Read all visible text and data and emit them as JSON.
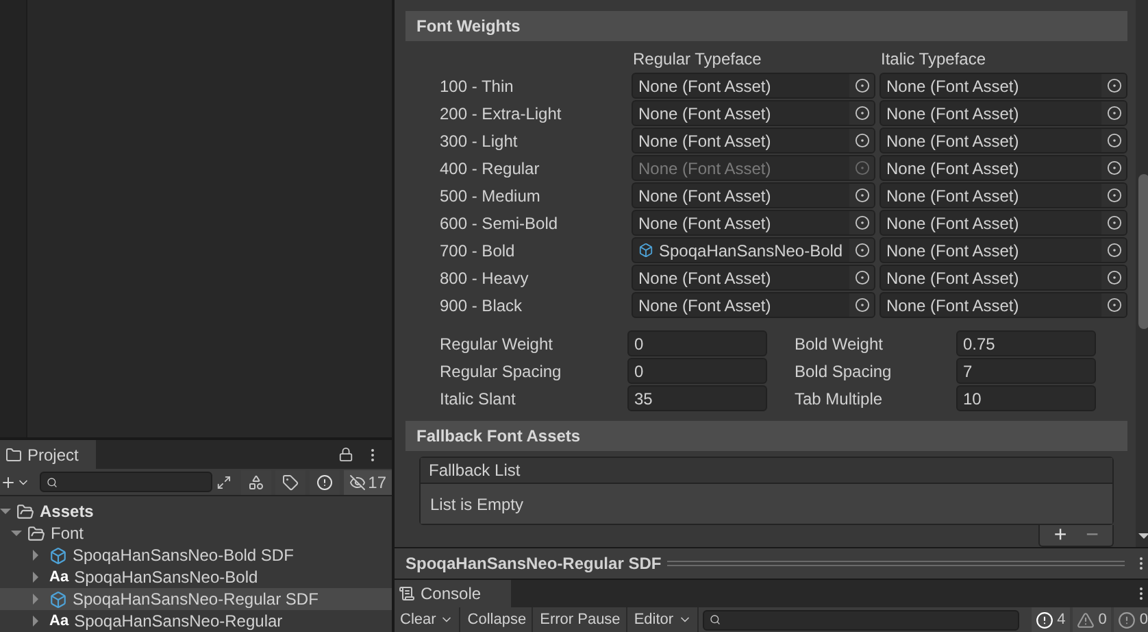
{
  "inspector": {
    "font_weights": {
      "title": "Font Weights",
      "columns": [
        "Regular Typeface",
        "Italic Typeface"
      ],
      "rows": [
        {
          "label": "100 - Thin",
          "regular": {
            "kind": "none",
            "text": "None (Font Asset)",
            "disabled": false
          },
          "italic": {
            "kind": "none",
            "text": "None (Font Asset)",
            "disabled": false
          }
        },
        {
          "label": "200 - Extra-Light",
          "regular": {
            "kind": "none",
            "text": "None (Font Asset)",
            "disabled": false
          },
          "italic": {
            "kind": "none",
            "text": "None (Font Asset)",
            "disabled": false
          }
        },
        {
          "label": "300 - Light",
          "regular": {
            "kind": "none",
            "text": "None (Font Asset)",
            "disabled": false
          },
          "italic": {
            "kind": "none",
            "text": "None (Font Asset)",
            "disabled": false
          }
        },
        {
          "label": "400 - Regular",
          "regular": {
            "kind": "none",
            "text": "None (Font Asset)",
            "disabled": true
          },
          "italic": {
            "kind": "none",
            "text": "None (Font Asset)",
            "disabled": false
          }
        },
        {
          "label": "500 - Medium",
          "regular": {
            "kind": "none",
            "text": "None (Font Asset)",
            "disabled": false
          },
          "italic": {
            "kind": "none",
            "text": "None (Font Asset)",
            "disabled": false
          }
        },
        {
          "label": "600 - Semi-Bold",
          "regular": {
            "kind": "none",
            "text": "None (Font Asset)",
            "disabled": false
          },
          "italic": {
            "kind": "none",
            "text": "None (Font Asset)",
            "disabled": false
          }
        },
        {
          "label": "700 - Bold",
          "regular": {
            "kind": "asset",
            "text": "SpoqaHanSansNeo-Bold",
            "disabled": false
          },
          "italic": {
            "kind": "none",
            "text": "None (Font Asset)",
            "disabled": false
          }
        },
        {
          "label": "800 - Heavy",
          "regular": {
            "kind": "none",
            "text": "None (Font Asset)",
            "disabled": false
          },
          "italic": {
            "kind": "none",
            "text": "None (Font Asset)",
            "disabled": false
          }
        },
        {
          "label": "900 - Black",
          "regular": {
            "kind": "none",
            "text": "None (Font Asset)",
            "disabled": false
          },
          "italic": {
            "kind": "none",
            "text": "None (Font Asset)",
            "disabled": false
          }
        }
      ],
      "settings": [
        {
          "label": "Regular Weight",
          "value": "0"
        },
        {
          "label": "Bold Weight",
          "value": "0.75"
        },
        {
          "label": "Regular Spacing",
          "value": "0"
        },
        {
          "label": "Bold Spacing",
          "value": "7"
        },
        {
          "label": "Italic Slant",
          "value": "35"
        },
        {
          "label": "Tab Multiple",
          "value": "10"
        }
      ]
    },
    "fallback": {
      "title": "Fallback Font Assets",
      "list_header": "Fallback List",
      "empty_text": "List is Empty",
      "add": "+",
      "remove": "−"
    },
    "preview_title": "SpoqaHanSansNeo-Regular SDF"
  },
  "project": {
    "tab": "Project",
    "hidden_count": "17",
    "tree": [
      {
        "label": "Assets",
        "kind": "folder",
        "expanded": true,
        "selected": false,
        "children": [
          {
            "label": "Font",
            "kind": "folder",
            "expanded": true,
            "selected": false,
            "children": [
              {
                "label": "SpoqaHanSansNeo-Bold SDF",
                "kind": "font_asset",
                "expanded": false,
                "selected": false
              },
              {
                "label": "SpoqaHanSansNeo-Bold",
                "kind": "font",
                "icon_text": "Aa",
                "expanded": false,
                "selected": false
              },
              {
                "label": "SpoqaHanSansNeo-Regular SDF",
                "kind": "font_asset",
                "expanded": false,
                "selected": true
              },
              {
                "label": "SpoqaHanSansNeo-Regular",
                "kind": "font",
                "icon_text": "Aa",
                "expanded": false,
                "selected": false
              }
            ]
          }
        ]
      }
    ]
  },
  "console": {
    "tab": "Console",
    "buttons": [
      {
        "label": "Clear",
        "kind": "split"
      },
      {
        "label": "Collapse",
        "kind": "toggle"
      },
      {
        "label": "Error Pause",
        "kind": "toggle"
      },
      {
        "label": "Editor",
        "kind": "dropdown"
      }
    ],
    "counts": [
      {
        "kind": "info",
        "text": "4"
      },
      {
        "kind": "warning",
        "text": "0"
      },
      {
        "kind": "error",
        "text": "0"
      }
    ]
  }
}
